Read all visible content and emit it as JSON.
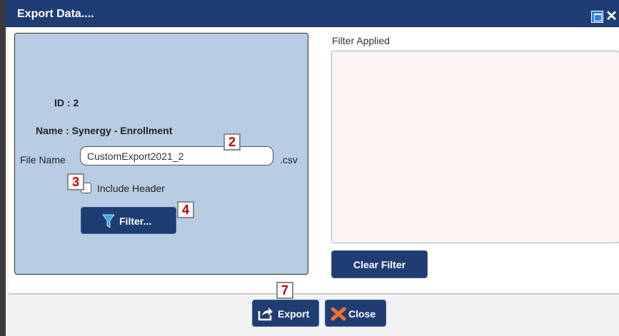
{
  "window": {
    "title": "Export Data...."
  },
  "info": {
    "id_label": "ID : 2",
    "name_label": "Name : Synergy - Enrollment"
  },
  "file": {
    "label": "File Name",
    "value": "CustomExport2021_2",
    "extension": ".csv"
  },
  "include_header": {
    "label": "Include Header",
    "checked": false
  },
  "filter_button": {
    "label": "Filter..."
  },
  "filter_applied": {
    "title": "Filter Applied"
  },
  "clear_filter_button": {
    "label": "Clear Filter"
  },
  "export_button": {
    "label": "Export"
  },
  "close_button": {
    "label": "Close"
  },
  "markers": {
    "m2": "2",
    "m3": "3",
    "m4": "4",
    "m7": "7"
  },
  "colors": {
    "title_bar": "#1f3d73",
    "panel": "#b8cde4",
    "button": "#1f3d73",
    "filter_box": "#fdf5f1",
    "marker_text": "#c00000"
  },
  "icons": {
    "maximize": "maximize-icon",
    "close": "close-icon",
    "filter": "funnel-icon",
    "export": "export-icon",
    "close_action": "x-icon"
  }
}
